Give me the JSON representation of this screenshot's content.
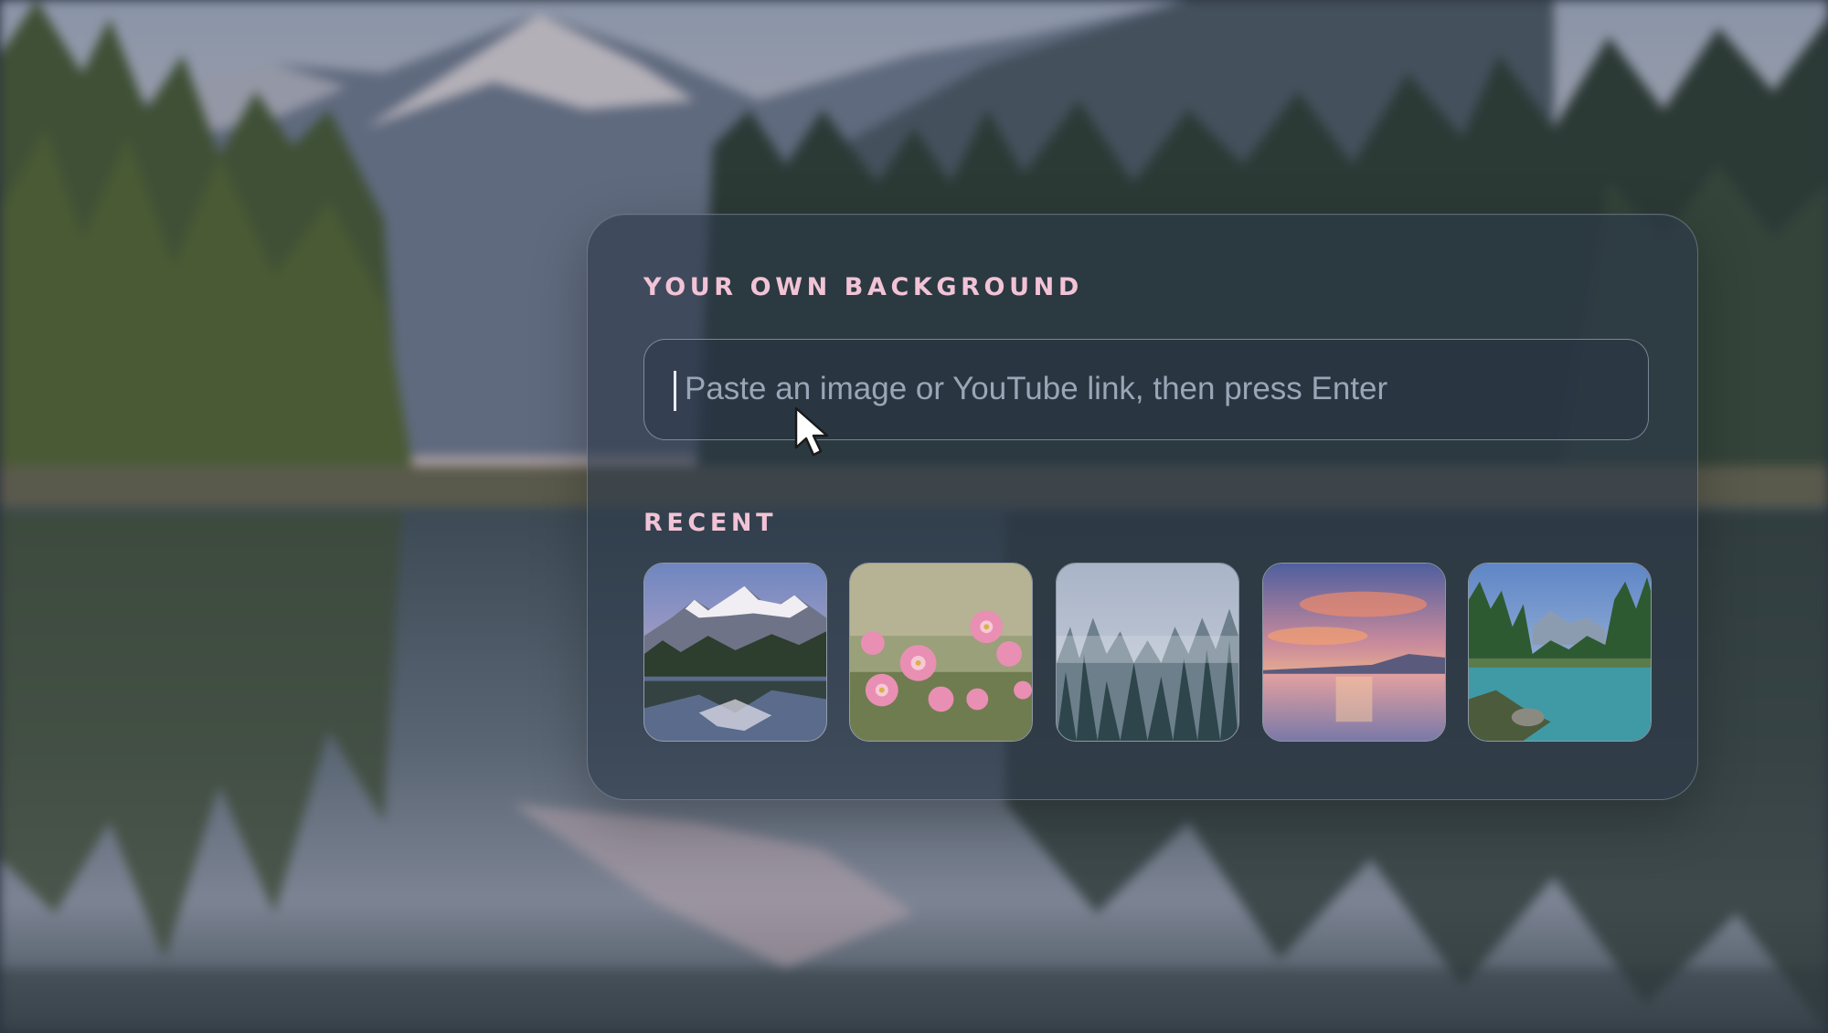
{
  "dialog": {
    "title": "YOUR OWN BACKGROUND",
    "input": {
      "placeholder": "Paste an image or YouTube link, then press Enter",
      "value": ""
    },
    "recent_label": "RECENT"
  },
  "recent": [
    {
      "name": "mountain-lake-thumbnail",
      "scene": "snowy mountains reflected in a lake"
    },
    {
      "name": "pink-flowers-thumbnail",
      "scene": "pink cosmos flowers"
    },
    {
      "name": "misty-forest-thumbnail",
      "scene": "misty pine forest"
    },
    {
      "name": "sunset-lake-thumbnail",
      "scene": "sunset over a lake"
    },
    {
      "name": "forest-river-thumbnail",
      "scene": "pine forest by a turquoise river"
    }
  ],
  "colors": {
    "label": "#f2c3d6",
    "placeholder": "#98a6b6",
    "panel": "#2c3848"
  }
}
